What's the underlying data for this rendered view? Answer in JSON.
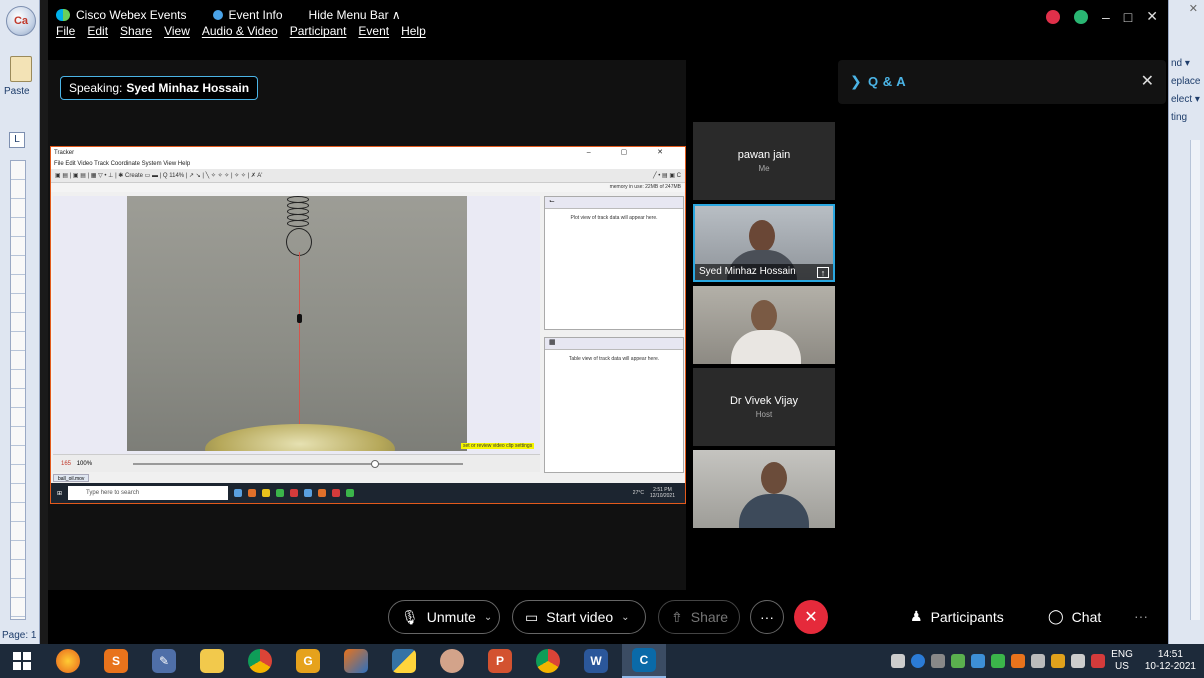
{
  "word": {
    "office_button": "Ca",
    "paste_label": "Paste",
    "ruler_button": "L",
    "page_label": "Page: 1",
    "right_items": [
      "nd ▾",
      "eplace",
      "elect ▾",
      "ting"
    ]
  },
  "webex": {
    "title_app": "Cisco Webex Events",
    "title_event_info": "Event Info",
    "title_hide_menu": "Hide Menu Bar ∧",
    "menu": [
      "File",
      "Edit",
      "Share",
      "View",
      "Audio & Video",
      "Participant",
      "Event",
      "Help"
    ],
    "speaking_prefix": "Speaking:",
    "speaking_name": "Syed Minhaz Hossain",
    "window_minimize": "–",
    "window_maximize": "□",
    "window_close": "✕"
  },
  "tracker": {
    "title": "Tracker",
    "menu": "File  Edit  Video  Track  Coordinate System  View  Help",
    "toolbar_text": "▣ ▤ | ▣ ▤ | ▦  ▽ •  ⊥ | ✱ Create  ▭  ▬ | Q 114% | ↗ ↘ | ╲ ✧ ✧ ✧ | ✧ ✧ | ✗  A'",
    "toolbar_right": "╱ •  ▤  ▣  C",
    "memory": "memory in use: 22MB of 247MB",
    "clip_settings": "set or review video clip settings",
    "frame": "165",
    "zoom": "100%",
    "plot_placeholder": "Plot view of track data will appear here.",
    "table_placeholder": "Table view of track data will appear here.",
    "file_tab": "ball_oil.mov",
    "search_placeholder": "Type here to search",
    "weather": "27°C",
    "clock_time": "2:51 PM",
    "clock_date": "12/10/2021"
  },
  "participants": [
    {
      "name": "pawan jain",
      "role": "Me"
    },
    {
      "name": "Syed Minhaz Hossain"
    },
    {
      "name": "Dr Vivek Vijay",
      "role": "Host"
    }
  ],
  "qa": {
    "title": "Q & A"
  },
  "controls": {
    "unmute": "Unmute",
    "start_video": "Start video",
    "share": "Share",
    "more": "···",
    "participants": "Participants",
    "chat": "Chat",
    "overflow": "···"
  },
  "taskbar": {
    "lang_top": "ENG",
    "lang_bottom": "US",
    "time": "14:51",
    "date": "10-12-2021"
  },
  "colors": {
    "accent": "#4bb4e6",
    "leave": "#e52a3b",
    "tracker_border": "#e35a1c"
  }
}
